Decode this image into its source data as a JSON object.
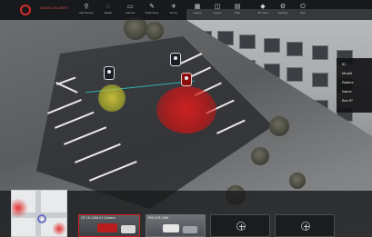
{
  "app": {
    "logo_text": "AVIGILON UNITY"
  },
  "toolbar": {
    "tools": [
      {
        "icon": "person-pin-icon",
        "label": "Add Sensor"
      },
      {
        "icon": "radar-icon",
        "label": "Radar"
      },
      {
        "icon": "camera-view-icon",
        "label": "Camera"
      },
      {
        "icon": "draw-zone-icon",
        "label": "Draw Zone"
      },
      {
        "icon": "drone-icon",
        "label": "Drone"
      },
      {
        "icon": "grid-icon",
        "label": "Layout"
      },
      {
        "icon": "layers-icon",
        "label": "Layers"
      },
      {
        "icon": "map-icon",
        "label": "Map"
      },
      {
        "icon": "view3d-icon",
        "label": "3D View"
      },
      {
        "icon": "settings-icon",
        "label": "Settings"
      },
      {
        "icon": "power-icon",
        "label": "Exit"
      }
    ]
  },
  "info_panel": {
    "fields": [
      "ID",
      "Model",
      "Radius",
      "Name",
      "Box IP"
    ]
  },
  "cameras": [
    {
      "label": "CE LK-CAM-01 Camera"
    },
    {
      "label": "PM-LKS-CAM"
    }
  ],
  "colors": {
    "accent": "#d72b2b",
    "alert_zone": "#e01e1e",
    "warning_zone": "#d4cc3c",
    "path": "#2fb3b3"
  }
}
